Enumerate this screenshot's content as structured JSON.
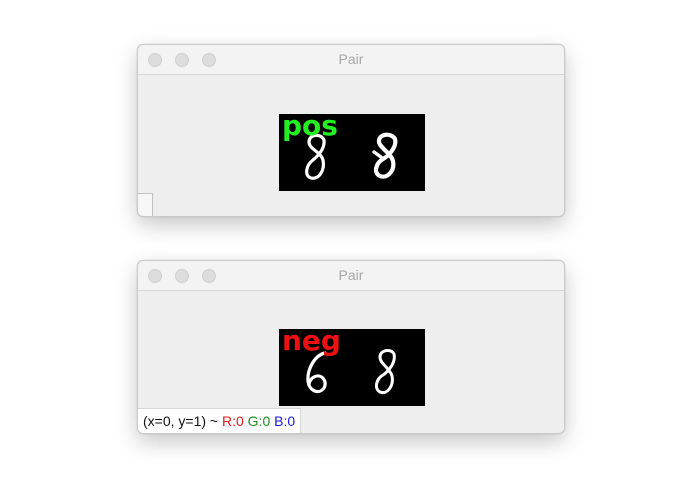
{
  "windows": [
    {
      "title": "Pair",
      "image": {
        "label": "pos",
        "label_color": "#22ee22",
        "left_digit": "8",
        "right_digit": "8"
      }
    },
    {
      "title": "Pair",
      "image": {
        "label": "neg",
        "label_color": "#ee1111",
        "left_digit": "6",
        "right_digit": "8"
      },
      "status": {
        "coords": "(x=0, y=1) ~",
        "r": "R:0",
        "g": "G:0",
        "b": "B:0"
      }
    }
  ],
  "icons": {
    "close": "close-button-icon",
    "minimize": "minimize-button-icon",
    "maximize": "maximize-button-icon"
  }
}
